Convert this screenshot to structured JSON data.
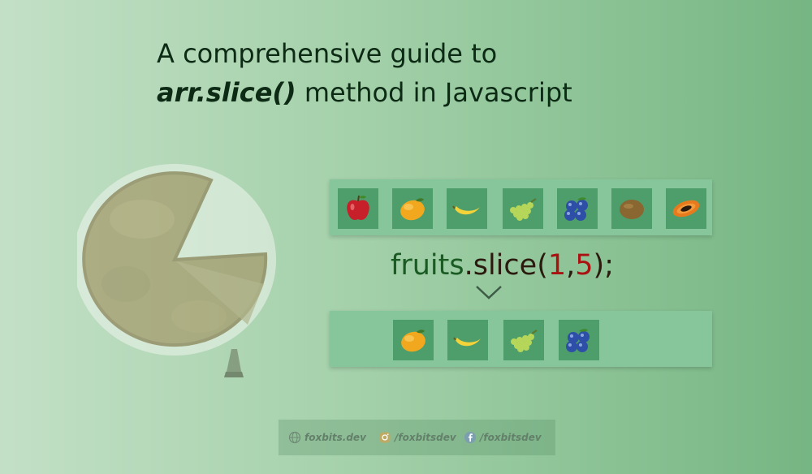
{
  "title": {
    "line1": "A comprehensive guide to",
    "code": "arr.slice()",
    "rest": " method in Javascript"
  },
  "illustration": {
    "icon": "cake-slice-icon"
  },
  "source_fruits": [
    "apple-icon",
    "mango-icon",
    "banana-icon",
    "grapes-icon",
    "blueberries-icon",
    "kiwi-icon",
    "papaya-icon"
  ],
  "sliced_fruits": [
    "mango-icon",
    "banana-icon",
    "grapes-icon",
    "blueberries-icon"
  ],
  "code": {
    "object": "fruits",
    "dot": ".",
    "method": "slice",
    "open": "(",
    "arg1": "1",
    "comma": ",",
    "arg2": "5",
    "close": ");"
  },
  "arrow_icon": "chevron-down-icon",
  "footer": {
    "website": {
      "icon": "globe-icon",
      "text": "foxbits.dev"
    },
    "instagram": {
      "icon": "instagram-icon",
      "text": "/foxbitsdev"
    },
    "facebook": {
      "icon": "facebook-icon",
      "text": "/foxbitsdev"
    }
  },
  "colors": {
    "title": "#0c2a14",
    "code_green": "#1a5a23",
    "code_red": "#aa1212",
    "tile_bg": "#4e9e6c",
    "strip_bg": "#86c69a"
  }
}
